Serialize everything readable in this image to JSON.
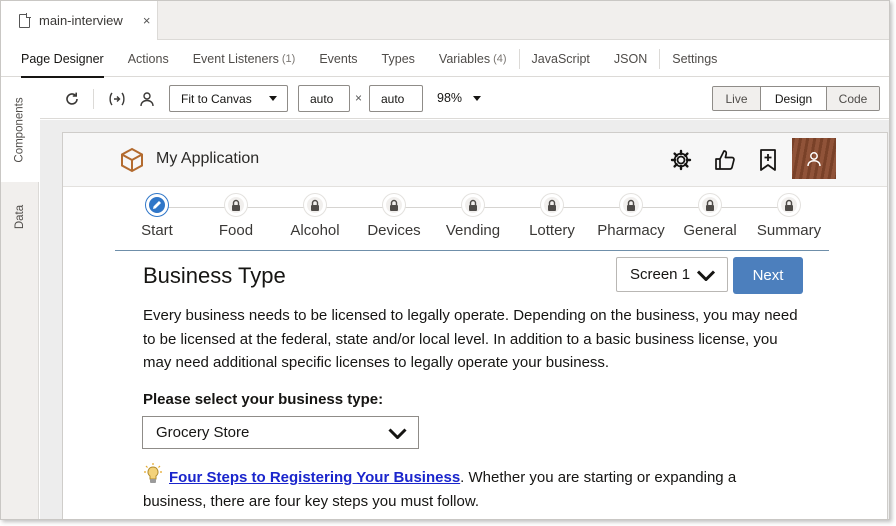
{
  "file_tab": {
    "name": "main-interview",
    "close": "×"
  },
  "designer_tabs": [
    {
      "label": "Page Designer",
      "count": ""
    },
    {
      "label": "Actions",
      "count": ""
    },
    {
      "label": "Event Listeners",
      "count": "(1)"
    },
    {
      "label": "Events",
      "count": ""
    },
    {
      "label": "Types",
      "count": ""
    },
    {
      "label": "Variables",
      "count": "(4)"
    },
    {
      "label": "JavaScript",
      "count": ""
    },
    {
      "label": "JSON",
      "count": ""
    },
    {
      "label": "Settings",
      "count": ""
    }
  ],
  "rail": {
    "components": "Components",
    "data": "Data"
  },
  "toolbar": {
    "fit_label": "Fit to Canvas",
    "width_value": "auto",
    "height_value": "auto",
    "times": "×",
    "zoom": "98%",
    "modes": [
      "Live",
      "Design",
      "Code"
    ],
    "selected_mode": "Design"
  },
  "app": {
    "title": "My Application",
    "steps": [
      "Start",
      "Food",
      "Alcohol",
      "Devices",
      "Vending",
      "Lottery",
      "Pharmacy",
      "General",
      "Summary"
    ],
    "current_step": "Start",
    "heading": "Business Type",
    "screen_select": "Screen 1",
    "next_label": "Next",
    "paragraph": "Every business needs to be licensed to legally operate. Depending on the business, you may need to be licensed at the federal, state and/or local level. In addition to a basic business license, you may need additional specific licenses to legally operate your business.",
    "select_prompt": "Please select your business type:",
    "business_type": "Grocery Store",
    "tip_link": "Four Steps to Registering Your Business",
    "tip_text": ". Whether you are starting or expanding a business, there are four key steps you must follow."
  },
  "colors": {
    "accent": "#2f76c8",
    "next_button": "#4c7fbd",
    "link": "#1a25cc",
    "avatar": "#8a4a2e"
  }
}
